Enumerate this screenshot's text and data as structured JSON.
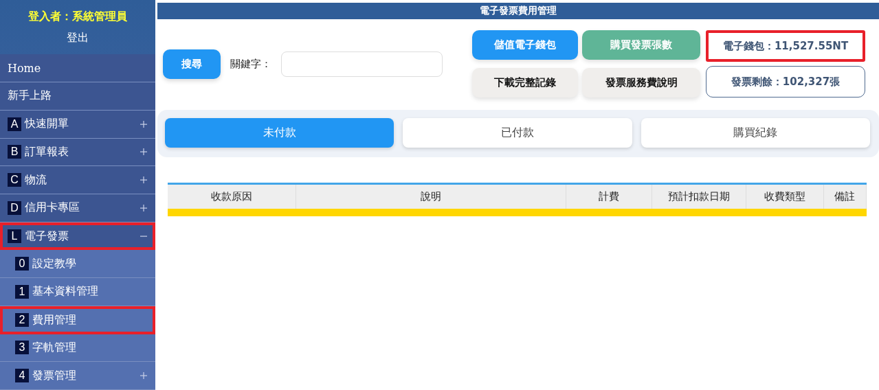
{
  "sidebar": {
    "user": "登入者：系統管理員",
    "logout": "登出",
    "items": [
      {
        "label": "Home"
      },
      {
        "label": "新手上路"
      },
      {
        "key": "A",
        "label": "快速開單",
        "expanded": false,
        "highlighted": false
      },
      {
        "key": "B",
        "label": "訂單報表",
        "expanded": false,
        "highlighted": false
      },
      {
        "key": "C",
        "label": "物流",
        "expanded": false,
        "highlighted": false
      },
      {
        "key": "D",
        "label": "信用卡專區",
        "expanded": false,
        "highlighted": false
      },
      {
        "key": "L",
        "label": "電子發票",
        "expanded": true,
        "highlighted": true,
        "children": [
          {
            "key": "0",
            "label": "設定教學",
            "highlighted": false
          },
          {
            "key": "1",
            "label": "基本資料管理",
            "highlighted": false
          },
          {
            "key": "2",
            "label": "費用管理",
            "highlighted": true
          },
          {
            "key": "3",
            "label": "字軌管理",
            "highlighted": false
          },
          {
            "key": "4",
            "label": "發票管理",
            "expanded": false,
            "highlighted": false
          }
        ]
      }
    ]
  },
  "page_title": "電子發票費用管理",
  "search": {
    "button": "搜尋",
    "label": "關鍵字："
  },
  "actions": [
    {
      "label": "儲值電子錢包",
      "kind": "primary"
    },
    {
      "label": "購買發票張數",
      "kind": "green"
    },
    {
      "label": "下載完整記錄",
      "kind": "plain"
    },
    {
      "label": "發票服務費說明",
      "kind": "plain"
    }
  ],
  "info": [
    {
      "text": "電子錢包：11,527.55NT",
      "highlighted": true
    },
    {
      "text": "發票剩餘：102,327張",
      "highlighted": false
    }
  ],
  "tabs": [
    {
      "label": "未付款",
      "selected": true
    },
    {
      "label": "已付款",
      "selected": false
    },
    {
      "label": "購買紀錄",
      "selected": false
    }
  ],
  "table": {
    "columns": [
      "收款原因",
      "說明",
      "計費",
      "預計扣款日期",
      "收費類型",
      "備註"
    ]
  }
}
